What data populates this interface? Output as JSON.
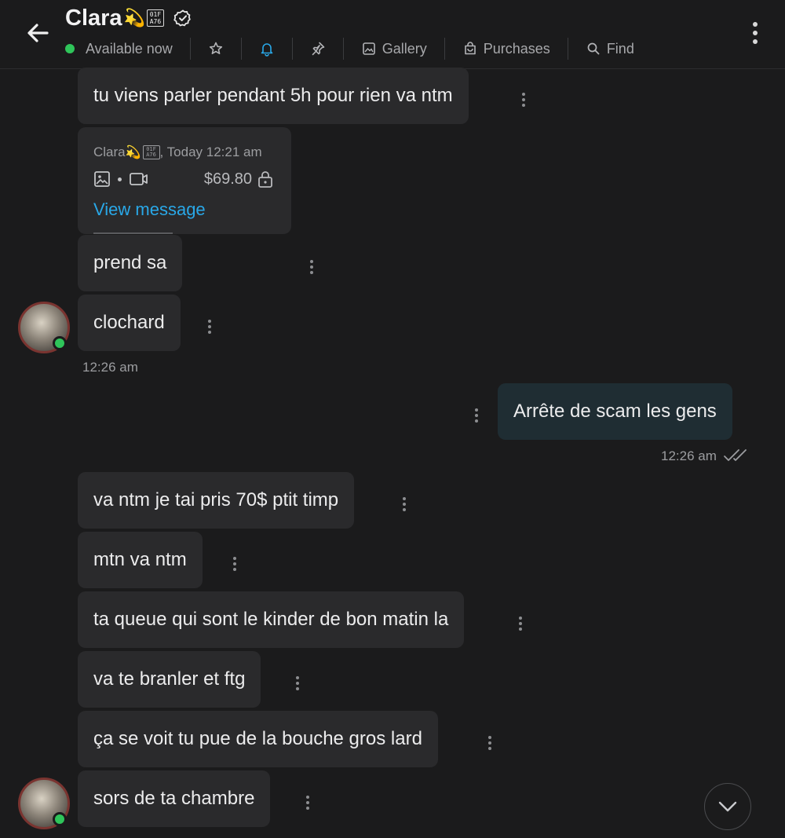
{
  "header": {
    "back_icon": "arrow-left-icon",
    "name": "Clara",
    "name_emoji": "💫",
    "name_tag": "01F\nA76",
    "verified_icon": "verified-badge-icon",
    "status": "Available now",
    "actions": [
      {
        "id": "favorite",
        "icon": "star-icon",
        "label": ""
      },
      {
        "id": "notifications",
        "icon": "bell-icon",
        "label": ""
      },
      {
        "id": "pin",
        "icon": "pin-icon",
        "label": ""
      },
      {
        "id": "gallery",
        "icon": "image-icon",
        "label": "Gallery"
      },
      {
        "id": "purchases",
        "icon": "bag-icon",
        "label": "Purchases"
      },
      {
        "id": "find",
        "icon": "search-icon",
        "label": "Find"
      }
    ],
    "menu_icon": "more-vertical-icon"
  },
  "messages": {
    "m1": "tu viens parler pendant 5h pour rien va ntm",
    "paid": {
      "sender": "Clara",
      "sender_emoji": "💫",
      "sender_tag": "01F\nA76",
      "when": ", Today 12:21 am",
      "price": "$69.80",
      "link": "View message"
    },
    "m2": "prend sa",
    "m3": "clochard",
    "t1": "12:26 am",
    "out1": "Arrête de scam les gens",
    "t2": "12:26 am",
    "m4": "va ntm je tai pris 70$ ptit timp",
    "m5": "mtn va ntm",
    "m6": "ta queue qui sont le kinder de bon matin la",
    "m7": "va te branler et ftg",
    "m8": "ça se voit tu pue de la bouche gros lard",
    "m9": "sors de ta chambre"
  },
  "colors": {
    "background": "#1b1b1c",
    "incoming_bubble": "#2a2a2c",
    "outgoing_bubble": "#1f2d33",
    "online": "#2fc55a",
    "link": "#29a8e8",
    "active_icon": "#29a8e8"
  }
}
